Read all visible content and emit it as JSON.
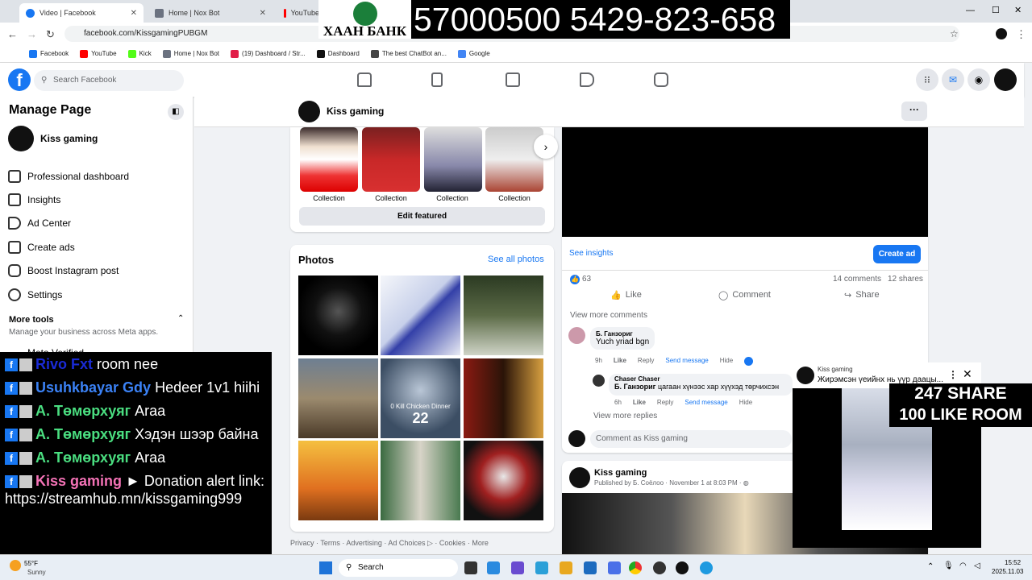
{
  "browser": {
    "tabs": [
      {
        "title": "Video | Facebook",
        "color": "#1877f2"
      },
      {
        "title": "Home | Nox Bot",
        "color": "#6b7280"
      },
      {
        "title": "YouTube",
        "color": "#ff0000"
      }
    ],
    "url": "facebook.com/KissgamingPUBGM",
    "bookmarks": [
      {
        "label": "Facebook",
        "color": "#1877f2"
      },
      {
        "label": "YouTube",
        "color": "#ff0000"
      },
      {
        "label": "Kick",
        "color": "#53fc18"
      },
      {
        "label": "Home | Nox Bot",
        "color": "#6b7280"
      },
      {
        "label": "(19) Dashboard / Str...",
        "color": "#e11d48"
      },
      {
        "label": "Dashboard",
        "color": "#111111"
      },
      {
        "label": "The best ChatBot an...",
        "color": "#444444"
      },
      {
        "label": "Google",
        "color": "#4285f4"
      }
    ]
  },
  "bank": {
    "name": "ХААН БАНК",
    "numbers": "57000500 5429-823-658"
  },
  "fb": {
    "search_placeholder": "Search Facebook",
    "logo": "f",
    "page_name": "Kiss gaming",
    "sidebar": {
      "title": "Manage Page",
      "page_name": "Kiss gaming",
      "items": [
        "Professional dashboard",
        "Insights",
        "Ad Center",
        "Create ads",
        "Boost Instagram post",
        "Settings"
      ],
      "more_tools": "More tools",
      "more_tools_sub": "Manage your business across Meta apps.",
      "meta_verified": "Meta Verified"
    }
  },
  "chat": [
    {
      "name": "Rivo Fxt",
      "color": "#1a2bd6",
      "text": "room nee"
    },
    {
      "name": "Usuhkbayar Gdy",
      "color": "#3b82f6",
      "text": "Hedeer 1v1 hiihi"
    },
    {
      "name": "А. Төмөрхуяг",
      "color": "#4ade80",
      "text": "Araa"
    },
    {
      "name": "А. Төмөрхуяг",
      "color": "#4ade80",
      "text": "Хэдэн шээр байна"
    },
    {
      "name": "А. Төмөрхуяг",
      "color": "#4ade80",
      "text": "Araa"
    },
    {
      "name": "Kiss gaming",
      "color": "#f472b6",
      "text": "► Donation alert link: https://streamhub.mn/kissgaming999"
    }
  ],
  "featured": {
    "labels": [
      "Collection",
      "Collection",
      "Collection",
      "Collection"
    ],
    "edit_button": "Edit featured"
  },
  "photos": {
    "title": "Photos",
    "see_all": "See all photos",
    "kill_text": "0 Kill Chicken Dinner",
    "kill_num": "22"
  },
  "footer": [
    "Privacy",
    "Terms",
    "Advertising",
    "Ad Choices",
    "Cookies",
    "More"
  ],
  "post": {
    "see_insights": "See insights",
    "create_ad": "Create ad",
    "reactions": "63",
    "comments_count": "14 comments",
    "shares_count": "12 shares",
    "actions": [
      "Like",
      "Comment",
      "Share"
    ],
    "view_more_comments": "View more comments",
    "comment1": {
      "author": "Б. Ганзориг",
      "text": "Yuch yriad bgn",
      "time": "9h",
      "like": "Like",
      "reply": "Reply",
      "send": "Send message",
      "hide": "Hide"
    },
    "reply1": {
      "author": "Chaser Chaser",
      "mention": "Б. Ганзориг",
      "text": "цагаан хүнээс хар хүүхэд төрчихсэн",
      "time": "6h",
      "like": "Like",
      "reply": "Reply",
      "send": "Send message",
      "hide": "Hide"
    },
    "view_more_replies": "View more replies",
    "comment_placeholder": "Comment as Kiss gaming"
  },
  "post2": {
    "author": "Kiss gaming",
    "published_by": "Published by",
    "publisher": "Б. Соёлоо",
    "date": "November 1 at 8:03 PM"
  },
  "video_overlay": {
    "channel": "Kiss gaming",
    "title": "Жирэмсэн үеийнх нь үүр даацы...",
    "share_text": "247 SHARE",
    "like_text": "100 LIKE ROOM"
  },
  "taskbar": {
    "temp": "55°F",
    "weather": "Sunny",
    "search": "Search",
    "time": "15:52",
    "date": "2025.11.03"
  }
}
